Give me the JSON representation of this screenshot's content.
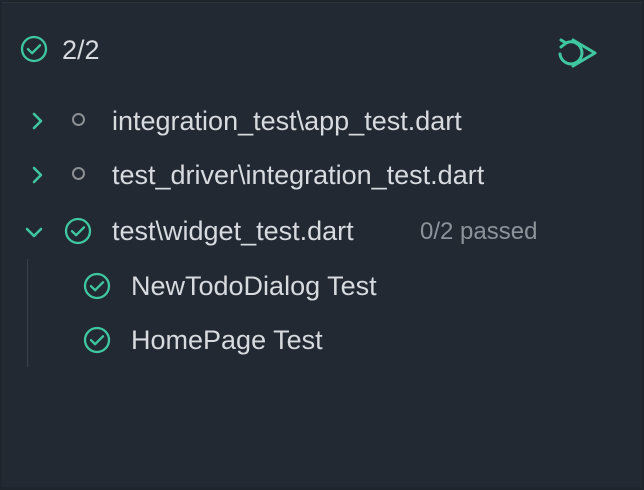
{
  "summary": {
    "count": "2/2",
    "status_icon": "check-circle-icon",
    "rerun_icon": "rerun-icon"
  },
  "tests": [
    {
      "label": "integration_test\\app_test.dart",
      "expanded": false,
      "status": "not-run"
    },
    {
      "label": "test_driver\\integration_test.dart",
      "expanded": false,
      "status": "not-run"
    },
    {
      "label": "test\\widget_test.dart",
      "expanded": true,
      "status": "passed",
      "meta": "0/2 passed",
      "children": [
        {
          "label": "NewTodoDialog Test",
          "status": "passed"
        },
        {
          "label": "HomePage Test",
          "status": "passed"
        }
      ]
    }
  ],
  "colors": {
    "accent": "#3ec7a0",
    "background": "#222932",
    "text": "#d7dadf",
    "muted": "#8e939a"
  }
}
